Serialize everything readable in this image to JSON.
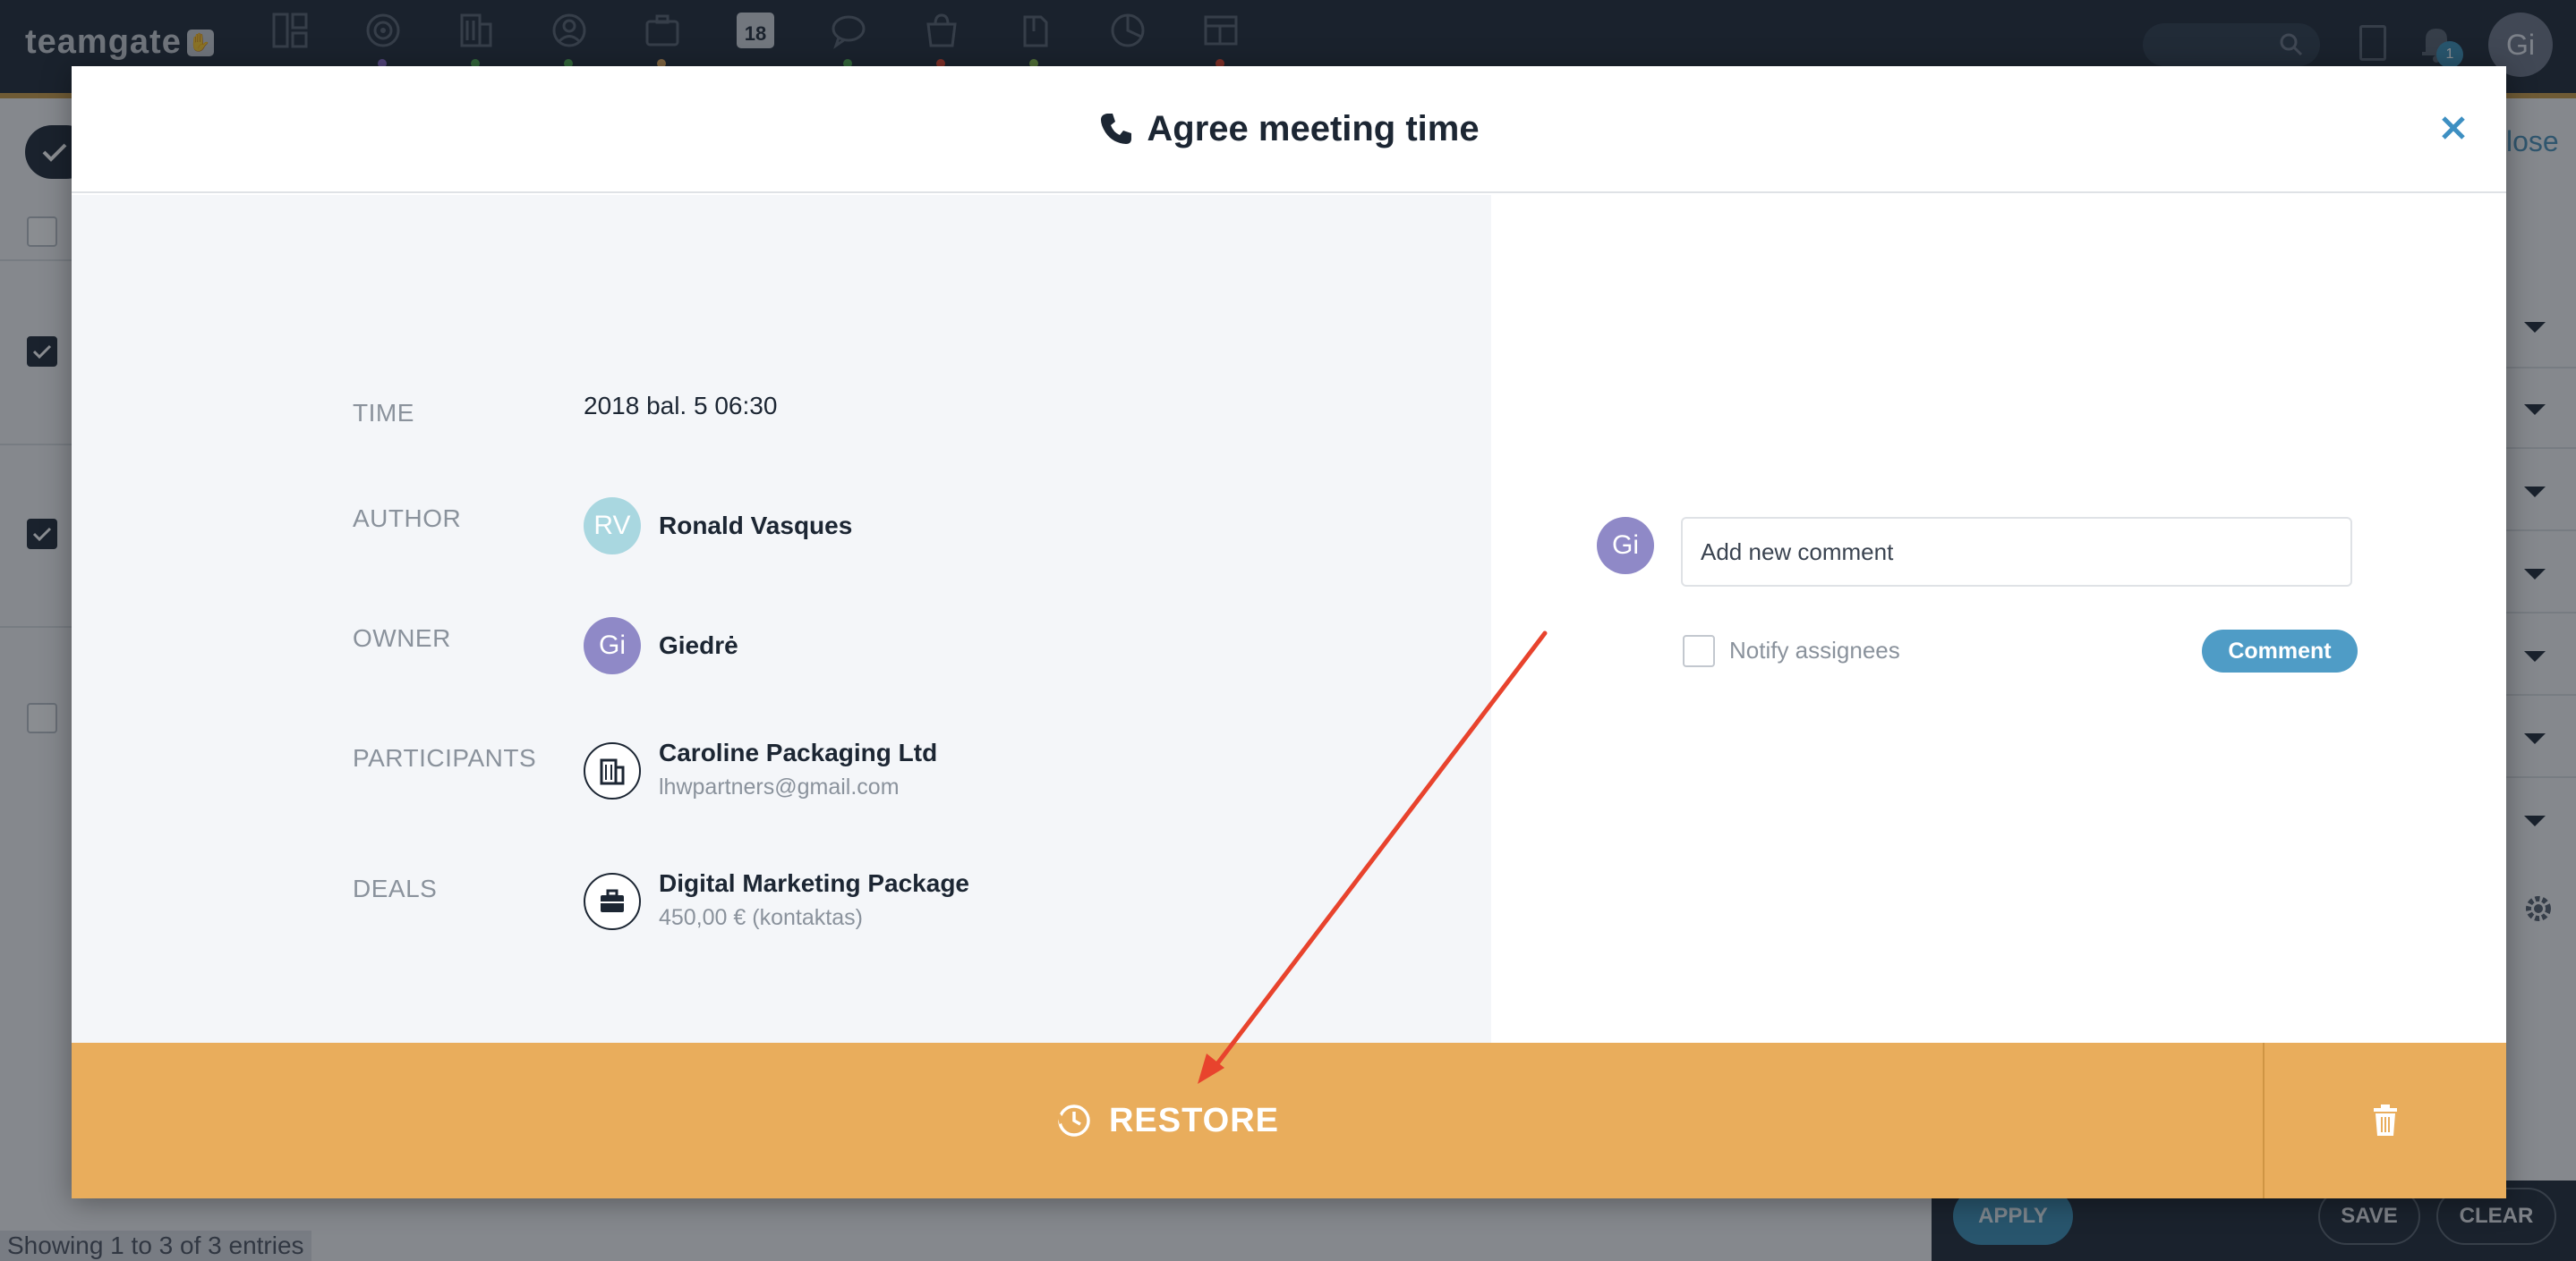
{
  "app": {
    "logo_text": "teamgate",
    "calendar_day": "18",
    "notification_count": "1",
    "user_initials": "Gi"
  },
  "background": {
    "close_link": "lose",
    "buttons": {
      "apply": "APPLY",
      "save": "SAVE",
      "clear": "CLEAR"
    },
    "entries_text": "Showing 1 to 3 of 3 entries"
  },
  "modal": {
    "title": "Agree meeting time",
    "fields": {
      "time": {
        "label": "TIME",
        "value": "2018 bal. 5 06:30"
      },
      "author": {
        "label": "AUTHOR",
        "initials": "RV",
        "name": "Ronald Vasques"
      },
      "owner": {
        "label": "OWNER",
        "initials": "Gi",
        "name": "Giedrė"
      },
      "participants": {
        "label": "PARTICIPANTS",
        "name": "Caroline Packaging Ltd",
        "email": "lhwpartners@gmail.com"
      },
      "deals": {
        "label": "DEALS",
        "name": "Digital Marketing Package",
        "amount": "450,00 € (kontaktas)"
      }
    },
    "comment": {
      "avatar_initials": "Gi",
      "placeholder": "Add new comment",
      "notify_label": "Notify assignees",
      "button_label": "Comment"
    },
    "footer": {
      "restore_label": "RESTORE"
    }
  },
  "colors": {
    "topbar": "#1e2836",
    "accent_blue": "#4f9cc6",
    "footer_orange": "#e9ad5c",
    "annotation_arrow": "#e8432d"
  }
}
